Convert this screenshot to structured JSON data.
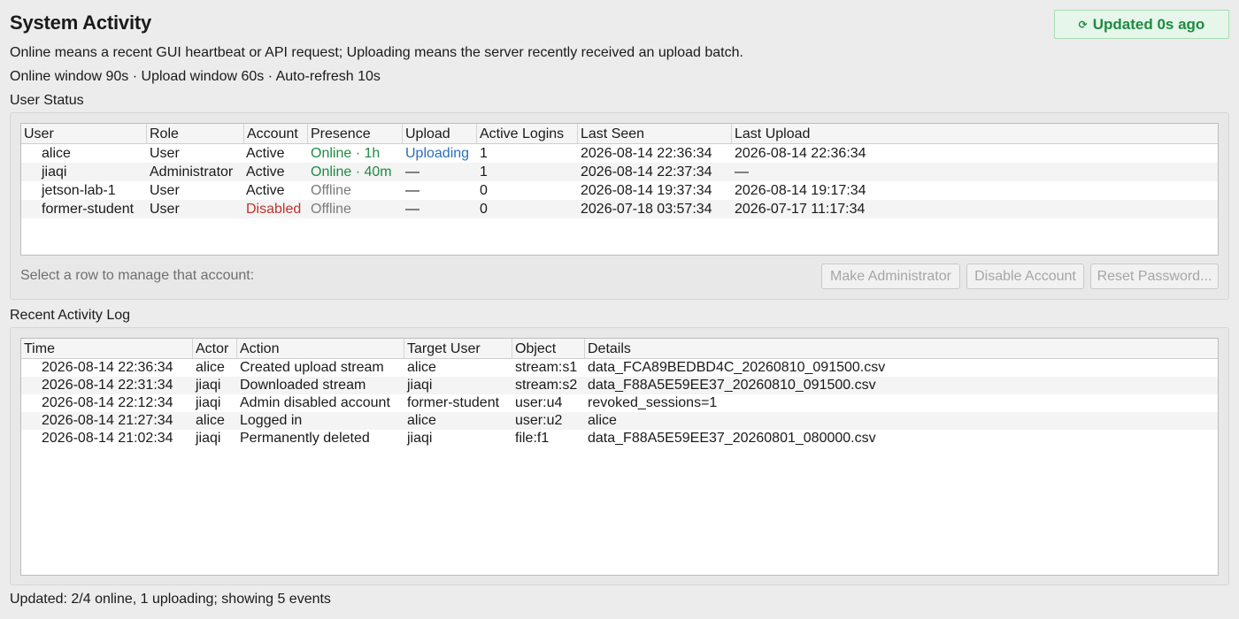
{
  "header": {
    "title": "System Activity",
    "updated_badge": "Updated 0s ago",
    "refresh_glyph": "⟳",
    "description": "Online means a recent GUI heartbeat or API request; Uploading means the server recently received an upload batch.",
    "windows": "Online window 90s · Upload window 60s · Auto-refresh 10s"
  },
  "user_status": {
    "label": "User Status",
    "columns": [
      "User",
      "Role",
      "Account",
      "Presence",
      "Upload",
      "Active Logins",
      "Last Seen",
      "Last Upload"
    ],
    "rows": [
      {
        "user": "alice",
        "role": "User",
        "account": "Active",
        "presence": "Online · 1h",
        "upload": "Uploading",
        "active_logins": "1",
        "last_seen": "2026-08-14 22:36:34",
        "last_upload": "2026-08-14 22:36:34"
      },
      {
        "user": "jiaqi",
        "role": "Administrator",
        "account": "Active",
        "presence": "Online · 40m",
        "upload": "—",
        "active_logins": "1",
        "last_seen": "2026-08-14 22:37:34",
        "last_upload": "—"
      },
      {
        "user": "jetson-lab-1",
        "role": "User",
        "account": "Active",
        "presence": "Offline",
        "upload": "—",
        "active_logins": "0",
        "last_seen": "2026-08-14 19:37:34",
        "last_upload": "2026-08-14 19:17:34"
      },
      {
        "user": "former-student",
        "role": "User",
        "account": "Disabled",
        "presence": "Offline",
        "upload": "—",
        "active_logins": "0",
        "last_seen": "2026-07-18 03:57:34",
        "last_upload": "2026-07-17 11:17:34"
      }
    ],
    "manage_hint": "Select a row to manage that account:",
    "buttons": {
      "make_admin": "Make Administrator",
      "disable": "Disable Account",
      "reset_password": "Reset Password..."
    }
  },
  "activity_log": {
    "label": "Recent Activity Log",
    "columns": [
      "Time",
      "Actor",
      "Action",
      "Target User",
      "Object",
      "Details"
    ],
    "rows": [
      {
        "time": "2026-08-14 22:36:34",
        "actor": "alice",
        "action": "Created upload stream",
        "target": "alice",
        "object": "stream:s1",
        "details": "data_FCA89BEDBD4C_20260810_091500.csv"
      },
      {
        "time": "2026-08-14 22:31:34",
        "actor": "jiaqi",
        "action": "Downloaded stream",
        "target": "jiaqi",
        "object": "stream:s2",
        "details": "data_F88A5E59EE37_20260810_091500.csv"
      },
      {
        "time": "2026-08-14 22:12:34",
        "actor": "jiaqi",
        "action": "Admin disabled account",
        "target": "former-student",
        "object": "user:u4",
        "details": "revoked_sessions=1"
      },
      {
        "time": "2026-08-14 21:27:34",
        "actor": "alice",
        "action": "Logged in",
        "target": "alice",
        "object": "user:u2",
        "details": "alice"
      },
      {
        "time": "2026-08-14 21:02:34",
        "actor": "jiaqi",
        "action": "Permanently deleted",
        "target": "jiaqi",
        "object": "file:f1",
        "details": "data_F88A5E59EE37_20260801_080000.csv"
      }
    ]
  },
  "status_bar": "Updated: 2/4 online, 1 uploading; showing 5 events",
  "colors": {
    "online": "#1e8a44",
    "uploading": "#2a6ebb",
    "offline": "#7a7a7a",
    "disabled": "#c0322b"
  }
}
